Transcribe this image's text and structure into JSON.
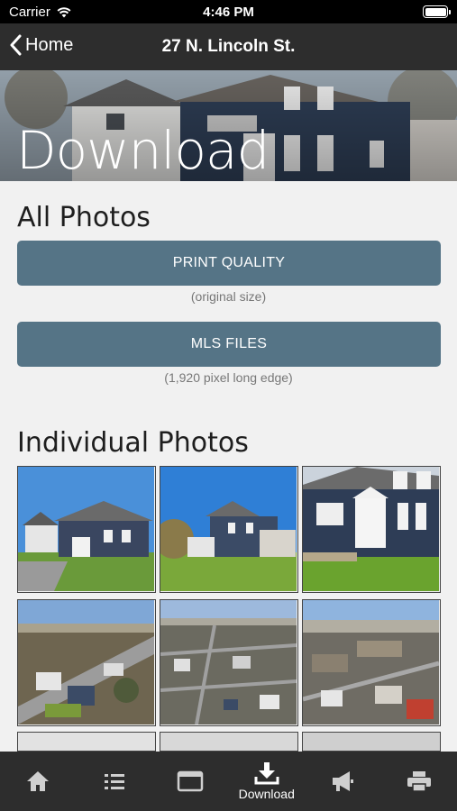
{
  "status_bar": {
    "carrier": "Carrier",
    "time": "4:46 PM"
  },
  "nav": {
    "back_label": "Home",
    "title": "27 N. Lincoln St."
  },
  "hero": {
    "heading": "Download"
  },
  "all_photos": {
    "title": "All Photos",
    "print_button": "PRINT QUALITY",
    "print_caption": "(original size)",
    "mls_button": "MLS FILES",
    "mls_caption": "(1,920 pixel long edge)"
  },
  "individual_photos": {
    "title": "Individual Photos"
  },
  "tabs": [
    {
      "icon": "home-icon",
      "label": ""
    },
    {
      "icon": "list-icon",
      "label": ""
    },
    {
      "icon": "browser-window-icon",
      "label": ""
    },
    {
      "icon": "download-icon",
      "label": "Download",
      "active": true
    },
    {
      "icon": "megaphone-icon",
      "label": ""
    },
    {
      "icon": "printer-icon",
      "label": ""
    }
  ],
  "colors": {
    "button": "#557486",
    "bar": "#2d2d2d",
    "background": "#f1f1f1"
  }
}
